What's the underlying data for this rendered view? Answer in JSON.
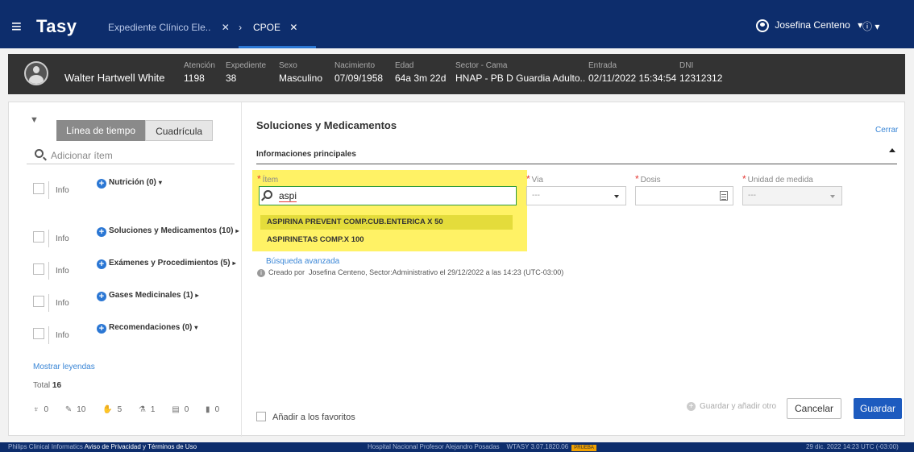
{
  "topbar": {
    "brand": "Tasy",
    "tabs": [
      {
        "label": "Expediente Clínico Ele..",
        "close": "✕",
        "chevron": "›"
      },
      {
        "label": "CPOE",
        "close": "✕"
      }
    ],
    "user": "Josefina Centeno",
    "user_caret": "▾",
    "info": "ⓘ ▾"
  },
  "patient": {
    "name": "Walter Hartwell White",
    "fields": [
      {
        "label": "Atención",
        "value": "1198"
      },
      {
        "label": "Expediente",
        "value": "38"
      },
      {
        "label": "Sexo",
        "value": "Masculino"
      },
      {
        "label": "Nacimiento",
        "value": "07/09/1958"
      },
      {
        "label": "Edad",
        "value": "64a 3m 22d"
      },
      {
        "label": "Sector - Cama",
        "value": "HNAP - PB D Guardia Adulto.."
      },
      {
        "label": "Entrada",
        "value": "02/11/2022 15:34:54"
      },
      {
        "label": "DNI",
        "value": "12312312"
      }
    ]
  },
  "left": {
    "view_toggle": {
      "active": "Línea de tiempo",
      "inactive": "Cuadrícula"
    },
    "search_placeholder": "Adicionar ítem",
    "info_label": "Info",
    "categories": [
      {
        "label": "Nutrición (0)",
        "arrow": "▾"
      },
      {
        "label": "Soluciones y Medicamentos (10)",
        "arrow": "▸"
      },
      {
        "label": "Exámenes y Procedimientos (5)",
        "arrow": "▸"
      },
      {
        "label": "Gases Medicinales (1)",
        "arrow": "▸"
      },
      {
        "label": "Recomendaciones (0)",
        "arrow": "▾"
      }
    ],
    "mostrar_leyendas": "Mostrar leyendas",
    "total_label": "Total",
    "total_value": "16",
    "counts": [
      "0",
      "10",
      "5",
      "1",
      "0",
      "0"
    ]
  },
  "form": {
    "title": "Soluciones y Medicamentos",
    "close": "Cerrar",
    "section": "Informaciones principales",
    "labels": {
      "item": "Ítem",
      "via": "Via",
      "dosis": "Dosis",
      "unidad": "Unidad de medida"
    },
    "item_value": "aspi",
    "via_value": "---",
    "unidad_value": "---",
    "options": [
      "ASPIRINA PREVENT COMP.CUB.ENTERICA X 50",
      "ASPIRINETAS COMP.X 100"
    ],
    "advanced": "Búsqueda avanzada",
    "created_prefix": "Creado por",
    "created_text": "Josefina Centeno, Sector:Administrativo el 29/12/2022 a las 14:23 (UTC-03:00)",
    "favoritos": "Añadir a los favoritos",
    "guardar_otro": "Guardar y añadir otro",
    "cancelar": "Cancelar",
    "guardar": "Guardar"
  },
  "footer": {
    "company": "Philips Clinical Informatics",
    "privacy": "Aviso de Privacidad y Términos de Uso",
    "hospital": "Hospital Nacional Profesor Alejandro Posadas",
    "version": "WTASY 3.07.1820.06",
    "env": "PRUEBA",
    "datetime": "29 dic. 2022  14:23  UTC (-03:00)"
  },
  "colors": {
    "topbar": "#0d2d6c",
    "accent": "#2b77d4",
    "highlight": "#fff04a",
    "required": "#e53935"
  }
}
